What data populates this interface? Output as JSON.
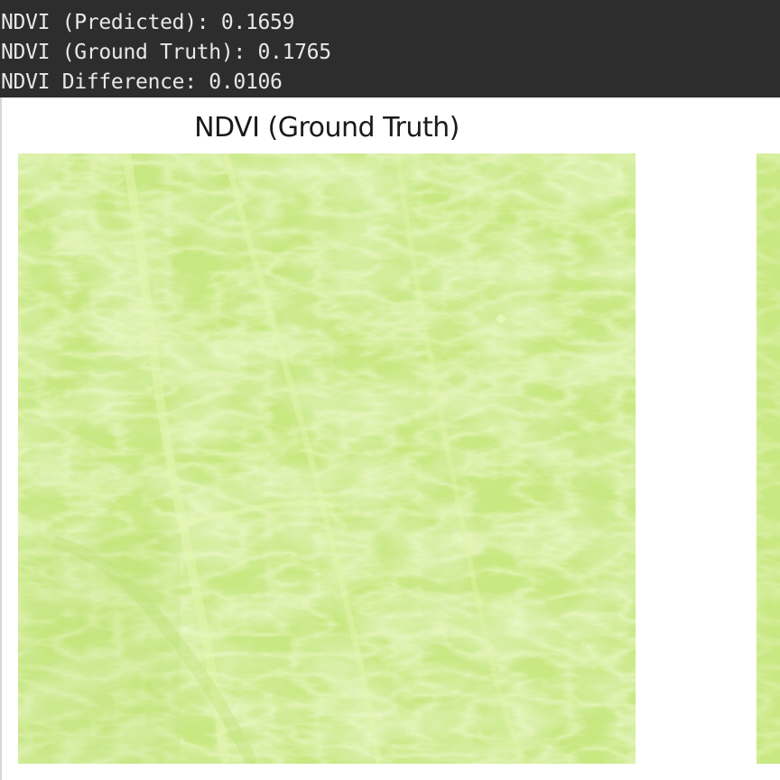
{
  "console": {
    "lines": [
      "NDVI (Predicted): 0.1659",
      "NDVI (Ground Truth): 0.1765",
      "NDVI Difference: 0.0106"
    ]
  },
  "figure": {
    "title": "NDVI (Ground Truth)",
    "colors": {
      "base": "#c8e882",
      "light": "#e2f5a8",
      "dark": "#b3db6a",
      "console_bg": "#2d2d2d"
    }
  }
}
